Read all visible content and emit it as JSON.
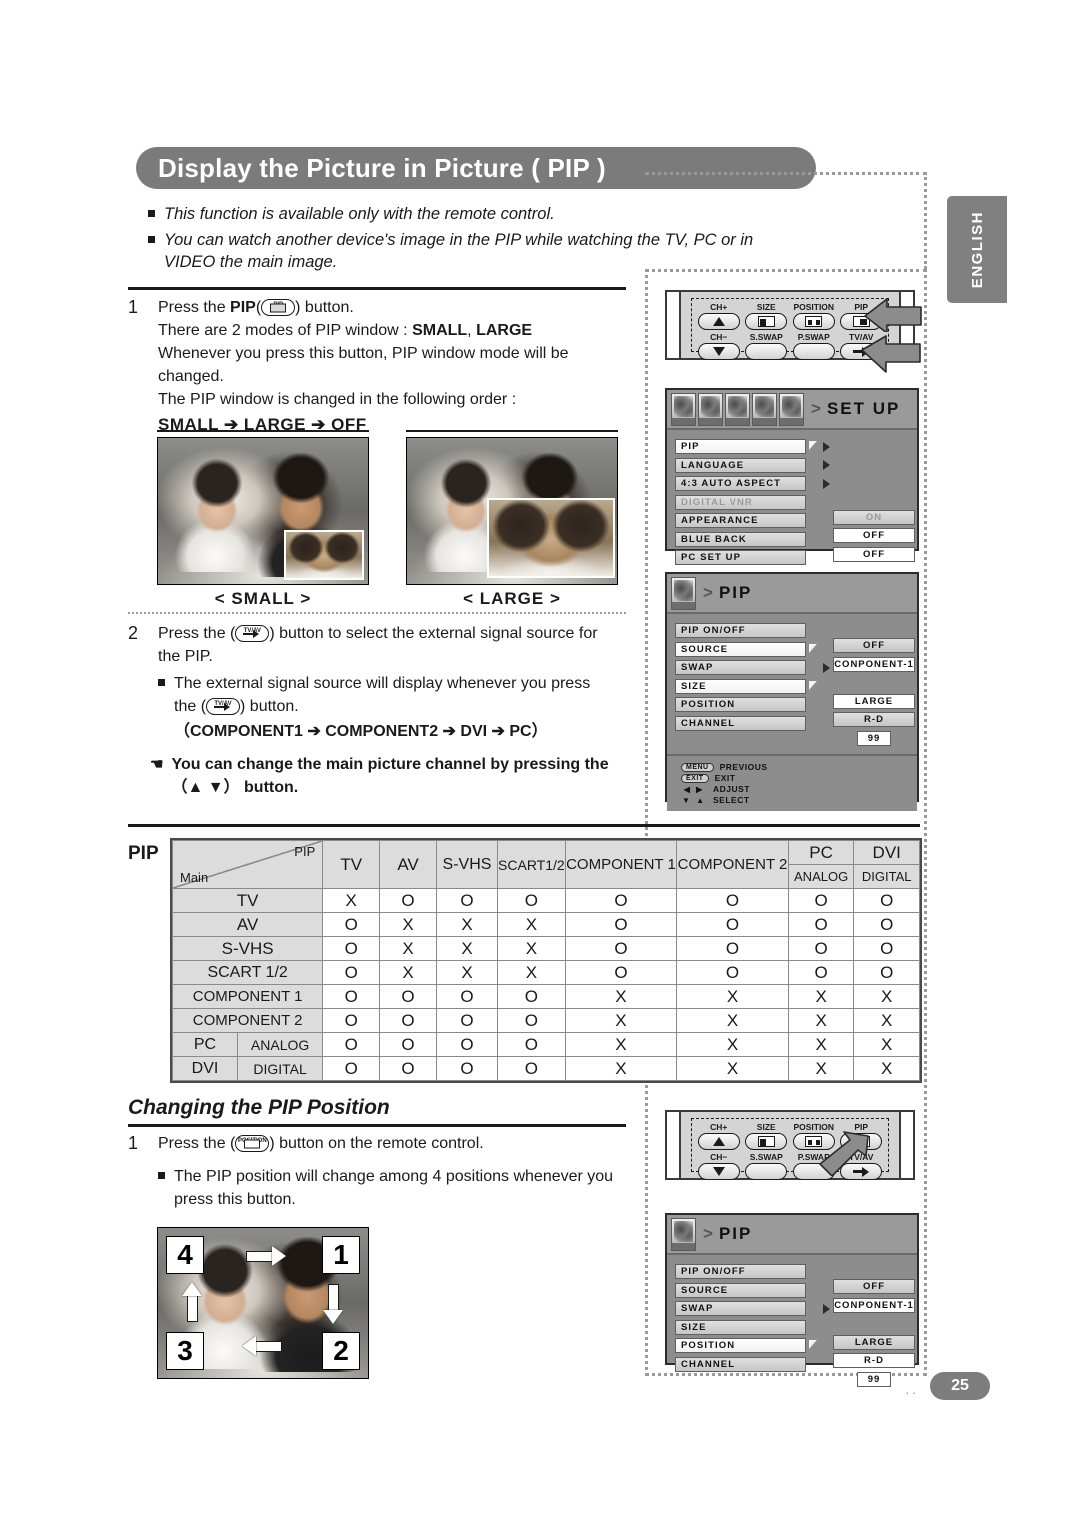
{
  "page": {
    "title": "Display the Picture in Picture ( PIP )",
    "language_tab": "ENGLISH",
    "page_number": "25",
    "accent_gray": "#7b7b7b"
  },
  "intro": {
    "bullets": [
      "This function is available only with the remote control.",
      "You can watch another device's image in the PIP while watching the TV, PC or in VIDEO the main image."
    ]
  },
  "step1": {
    "number": "1",
    "line1_pre": "Press the ",
    "line1_bold": "PIP",
    "line1_post": " button.",
    "line2_pre": "There are 2 modes of PIP window : ",
    "line2_b1": "SMALL",
    "line2_mid": ", ",
    "line2_b2": "LARGE",
    "line3": "Whenever you press this button, PIP window mode will be",
    "line4": "changed.",
    "line5": "The PIP window is changed in the following order :",
    "order": "SMALL ➔ LARGE ➔ OFF",
    "key_label": "PIP"
  },
  "examples": {
    "small_caption": "< SMALL >",
    "large_caption": "< LARGE >"
  },
  "step2": {
    "number": "2",
    "line1_pre": "Press the ",
    "line1_post": " button to select the external signal source for",
    "line2": "the PIP.",
    "bullet_line1": "The external signal source will display whenever you press",
    "bullet_line2_pre": "the ",
    "bullet_line2_post": " button.",
    "sequence": "（COMPONENT1 ➔ COMPONENT2 ➔ DVI ➔ PC）",
    "hand_line1": "You can change the main picture channel by pressing the",
    "hand_line2": "（▲ ▼） button.",
    "key_label": "TV/AV"
  },
  "pip_table": {
    "label": "PIP",
    "corner_top": "PIP",
    "corner_bottom": "Main",
    "columns": [
      "TV",
      "AV",
      "S-VHS",
      "SCART1/2",
      "COMPONENT 1",
      "COMPONENT 2",
      "PC",
      "DVI"
    ],
    "col_sub": [
      "",
      "",
      "",
      "",
      "",
      "",
      "ANALOG",
      "DIGITAL"
    ],
    "rows": [
      {
        "name": "TV",
        "sub": "",
        "values": [
          "X",
          "O",
          "O",
          "O",
          "O",
          "O",
          "O",
          "O"
        ]
      },
      {
        "name": "AV",
        "sub": "",
        "values": [
          "O",
          "X",
          "X",
          "X",
          "O",
          "O",
          "O",
          "O"
        ]
      },
      {
        "name": "S-VHS",
        "sub": "",
        "values": [
          "O",
          "X",
          "X",
          "X",
          "O",
          "O",
          "O",
          "O"
        ]
      },
      {
        "name": "SCART 1/2",
        "sub": "",
        "values": [
          "O",
          "X",
          "X",
          "X",
          "O",
          "O",
          "O",
          "O"
        ]
      },
      {
        "name": "COMPONENT 1",
        "sub": "",
        "values": [
          "O",
          "O",
          "O",
          "O",
          "X",
          "X",
          "X",
          "X"
        ]
      },
      {
        "name": "COMPONENT 2",
        "sub": "",
        "values": [
          "O",
          "O",
          "O",
          "O",
          "X",
          "X",
          "X",
          "X"
        ]
      },
      {
        "name": "PC",
        "sub": "ANALOG",
        "values": [
          "O",
          "O",
          "O",
          "O",
          "X",
          "X",
          "X",
          "X"
        ]
      },
      {
        "name": "DVI",
        "sub": "DIGITAL",
        "values": [
          "O",
          "O",
          "O",
          "O",
          "X",
          "X",
          "X",
          "X"
        ]
      }
    ]
  },
  "section2": {
    "title": "Changing the PIP Position",
    "step_number": "1",
    "line1_pre": "Press the ",
    "line1_post": " button on the remote control.",
    "bullet_line1": "The PIP position will change among 4 positions whenever you",
    "bullet_line2": "press this button.",
    "key_label": "POSITION",
    "positions": [
      "4",
      "1",
      "3",
      "2"
    ]
  },
  "remote": {
    "keys_row1": [
      {
        "label": "CH+",
        "icon": "up-arrow-icon"
      },
      {
        "label": "SIZE",
        "icon": "size-icon"
      },
      {
        "label": "POSITION",
        "icon": "position-icon"
      },
      {
        "label": "PIP",
        "icon": "pip-icon"
      }
    ],
    "keys_row2": [
      {
        "label": "CH−",
        "icon": "down-arrow-icon"
      },
      {
        "label": "S.SWAP",
        "icon": "blank-icon"
      },
      {
        "label": "P.SWAP",
        "icon": "blank-icon"
      },
      {
        "label": "TV/AV",
        "icon": "tvav-icon"
      }
    ]
  },
  "setup_menu": {
    "title": "SET UP",
    "title_prefix": ">",
    "items": [
      {
        "label": "PIP",
        "flag": true,
        "arrow": true,
        "value": "",
        "dim": false
      },
      {
        "label": "LANGUAGE",
        "flag": false,
        "arrow": true,
        "value": "",
        "dim": false
      },
      {
        "label": "4:3 AUTO ASPECT",
        "flag": false,
        "arrow": true,
        "value": "",
        "dim": false
      },
      {
        "label": "DIGITAL VNR",
        "flag": false,
        "arrow": false,
        "value": "ON",
        "dim": true
      },
      {
        "label": "APPEARANCE",
        "flag": false,
        "arrow": false,
        "value": "OFF",
        "dim": false
      },
      {
        "label": "BLUE BACK",
        "flag": false,
        "arrow": false,
        "value": "OFF",
        "dim": false
      },
      {
        "label": "PC SET UP",
        "flag": false,
        "arrow": false,
        "value": "",
        "dim": false
      }
    ]
  },
  "pip_menu_top": {
    "title": "PIP",
    "title_prefix": ">",
    "items": [
      {
        "label": "PIP ON/OFF",
        "flag": false,
        "arrow": false,
        "value": "OFF",
        "white": false
      },
      {
        "label": "SOURCE",
        "flag": true,
        "arrow": false,
        "value": "CONPONENT-1",
        "white": true
      },
      {
        "label": "SWAP",
        "flag": false,
        "arrow": true,
        "value": "",
        "white": false
      },
      {
        "label": "SIZE",
        "flag": true,
        "arrow": false,
        "value": "LARGE",
        "white": true
      },
      {
        "label": "POSITION",
        "flag": false,
        "arrow": false,
        "value": "R-D",
        "white": false
      },
      {
        "label": "CHANNEL",
        "flag": false,
        "arrow": false,
        "value": "99",
        "white": false,
        "small": true
      }
    ],
    "footer": [
      {
        "key": "MENU",
        "text": "PREVIOUS"
      },
      {
        "key": "EXIT",
        "text": "EXIT"
      },
      {
        "key": "◀ ▶",
        "text": "ADJUST",
        "plain": true
      },
      {
        "key": "▼ ▲",
        "text": "SELECT",
        "plain": true
      }
    ]
  },
  "pip_menu_bottom": {
    "title": "PIP",
    "title_prefix": ">",
    "items": [
      {
        "label": "PIP ON/OFF",
        "flag": false,
        "arrow": false,
        "value": "OFF",
        "white": false
      },
      {
        "label": "SOURCE",
        "flag": false,
        "arrow": false,
        "value": "CONPONENT-1",
        "white": true
      },
      {
        "label": "SWAP",
        "flag": false,
        "arrow": true,
        "value": "",
        "white": false
      },
      {
        "label": "SIZE",
        "flag": false,
        "arrow": false,
        "value": "LARGE",
        "white": false
      },
      {
        "label": "POSITION",
        "flag": true,
        "arrow": false,
        "value": "R-D",
        "white": true
      },
      {
        "label": "CHANNEL",
        "flag": false,
        "arrow": false,
        "value": "99",
        "white": false,
        "small": true
      }
    ]
  }
}
